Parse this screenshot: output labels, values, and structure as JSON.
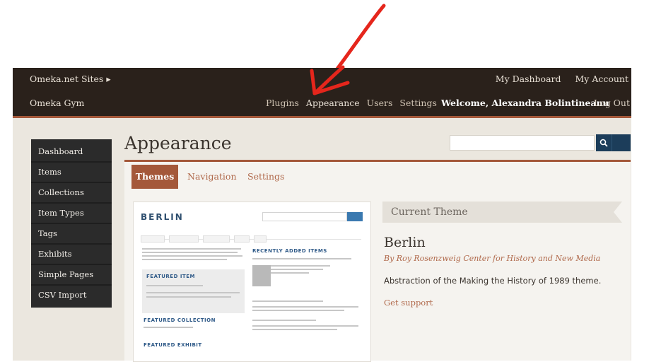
{
  "annotation": {
    "color": "#e5261c"
  },
  "topbar": {
    "sites_label": "Omeka.net Sites ▸",
    "my_dashboard": "My Dashboard",
    "my_account": "My Account"
  },
  "navbar": {
    "site_name": "Omeka Gym",
    "items": [
      "Plugins",
      "Appearance",
      "Users",
      "Settings"
    ],
    "welcome": "Welcome, Alexandra Bolintineanu",
    "logout": "Log Out"
  },
  "sidebar": {
    "items": [
      "Dashboard",
      "Items",
      "Collections",
      "Item Types",
      "Tags",
      "Exhibits",
      "Simple Pages",
      "CSV Import"
    ]
  },
  "main": {
    "title": "Appearance",
    "tabs": [
      "Themes",
      "Navigation",
      "Settings"
    ],
    "search_placeholder": "",
    "search_icon": "magnifier-icon"
  },
  "preview": {
    "brand": "BERLIN",
    "featured_item": "FEATURED ITEM",
    "recently_added": "RECENTLY ADDED ITEMS",
    "featured_collection": "FEATURED COLLECTION",
    "featured_exhibit": "FEATURED EXHIBIT"
  },
  "current_theme": {
    "heading": "Current Theme",
    "name": "Berlin",
    "author": "By Roy Rosenzweig Center for History and New Media",
    "description": "Abstraction of the Making the History of 1989 theme.",
    "support": "Get support"
  },
  "colors": {
    "bar_bg": "#2a211b",
    "accent": "#a4583a",
    "search_button": "#1c3d5a"
  }
}
